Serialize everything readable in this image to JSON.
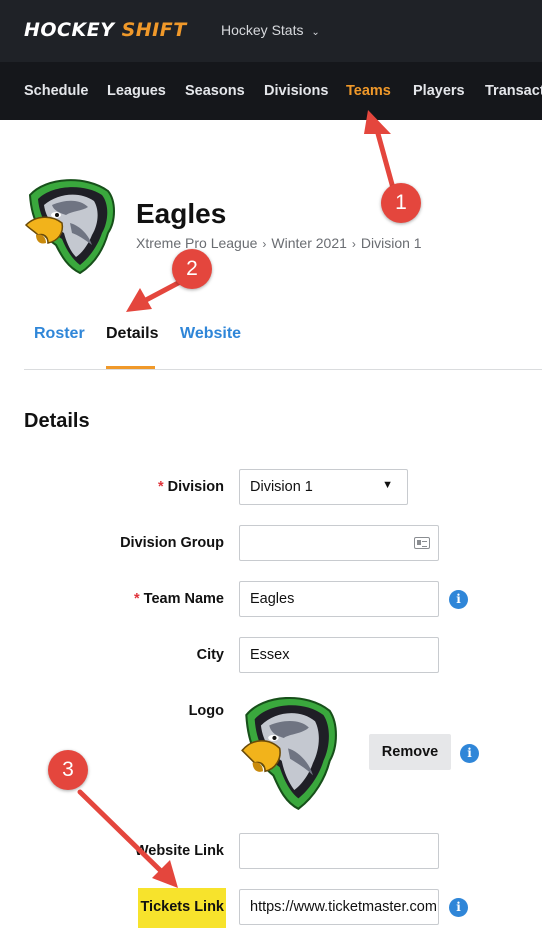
{
  "header": {
    "brand_part1": "HOCKEY",
    "brand_part2": "SHIFT",
    "app_switcher": "Hockey Stats",
    "chevron": "⌄"
  },
  "nav": {
    "items": [
      {
        "label": "Schedule"
      },
      {
        "label": "Leagues"
      },
      {
        "label": "Seasons"
      },
      {
        "label": "Divisions"
      },
      {
        "label": "Teams"
      },
      {
        "label": "Players"
      },
      {
        "label": "Transacti"
      }
    ],
    "active": "Teams"
  },
  "team": {
    "name": "Eagles",
    "breadcrumb": [
      "Xtreme Pro League",
      "Winter 2021",
      "Division 1"
    ],
    "breadcrumb_separator": "›",
    "logo_icon": "eagle-logo"
  },
  "tabs": [
    {
      "label": "Roster"
    },
    {
      "label": "Details"
    },
    {
      "label": "Website"
    }
  ],
  "details": {
    "title": "Details",
    "required_mark": "*",
    "division": {
      "label": "Division",
      "value": "Division 1",
      "caret": "▼"
    },
    "division_group": {
      "label": "Division Group",
      "value": ""
    },
    "team_name": {
      "label": "Team Name",
      "value": "Eagles"
    },
    "city": {
      "label": "City",
      "value": "Essex"
    },
    "logo": {
      "label": "Logo",
      "remove_label": "Remove"
    },
    "website_link": {
      "label": "Website Link",
      "value": ""
    },
    "tickets_link": {
      "label": "Tickets Link",
      "value": "https://www.ticketmaster.com"
    }
  },
  "info_glyph": "i",
  "callouts": [
    "1",
    "2",
    "3"
  ],
  "colors": {
    "accent": "#f0992a",
    "link": "#2f86d8",
    "callout": "#e4463d",
    "highlight": "#f7e32c",
    "topbar": "#1f2227",
    "navbar": "#15171b"
  }
}
